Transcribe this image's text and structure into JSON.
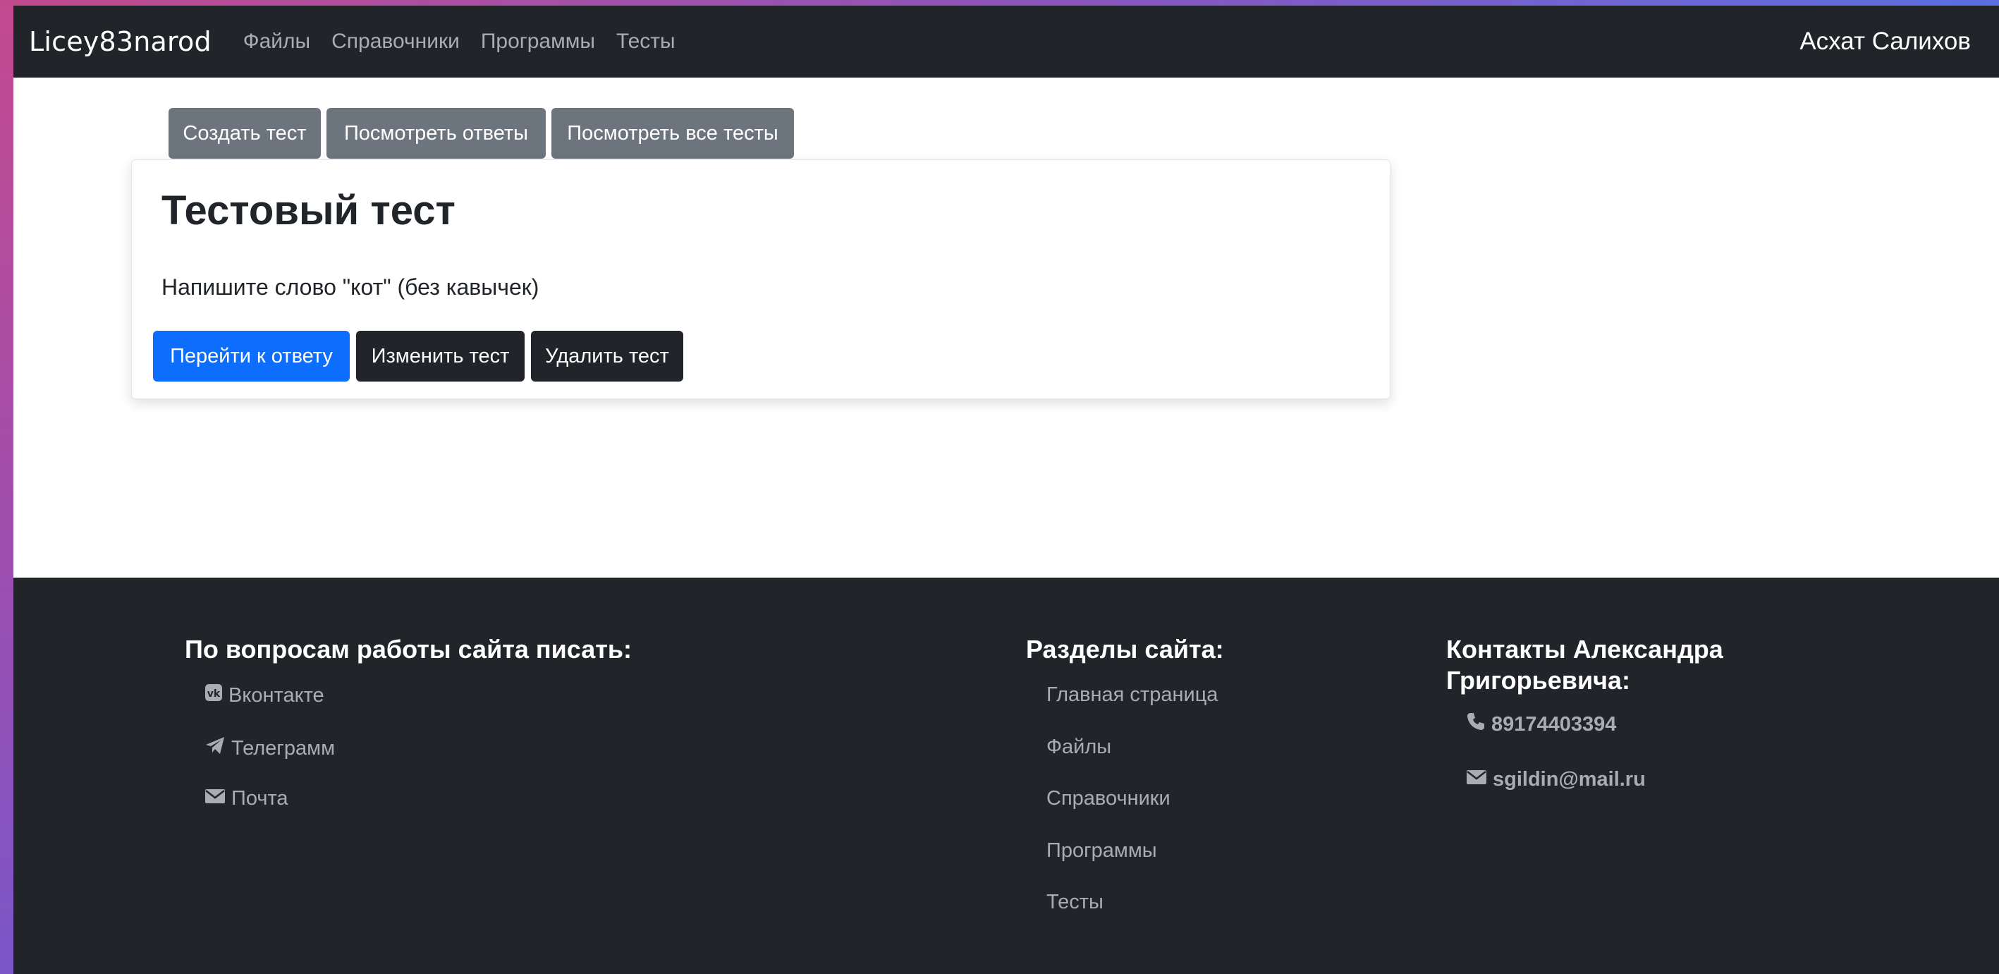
{
  "navbar": {
    "brand": "Licey83narod",
    "links": [
      "Файлы",
      "Справочники",
      "Программы",
      "Тесты"
    ],
    "user": "Асхат Салихов"
  },
  "toolbar": {
    "create_label": "Создать тест",
    "answers_label": "Посмотреть ответы",
    "all_tests_label": "Посмотреть все тесты"
  },
  "test_card": {
    "title": "Тестовый тест",
    "question": "Напишите слово \"кот\" (без кавычек)",
    "go_to_answer_label": "Перейти к ответу",
    "edit_label": "Изменить тест",
    "delete_label": "Удалить тест"
  },
  "footer": {
    "support": {
      "heading": "По вопросам работы сайта писать:",
      "links": [
        {
          "label": "Вконтакте",
          "icon": "vk-icon"
        },
        {
          "label": "Телеграмм",
          "icon": "telegram-icon"
        },
        {
          "label": "Почта",
          "icon": "envelope-icon"
        }
      ]
    },
    "sections": {
      "heading": "Разделы сайта:",
      "links": [
        "Главная страница",
        "Файлы",
        "Справочники",
        "Программы",
        "Тесты"
      ]
    },
    "contacts": {
      "heading_line1": "Контакты Александра",
      "heading_line2": "Григорьевича:",
      "phone": "89174403394",
      "email": "sgildin@mail.ru",
      "phone_icon": "phone-icon",
      "email_icon": "envelope-icon"
    }
  },
  "colors": {
    "navbar_bg": "#212529",
    "primary": "#0d6efd",
    "secondary": "#6c757d",
    "dark": "#212529",
    "muted_link": "#a9adb2"
  }
}
